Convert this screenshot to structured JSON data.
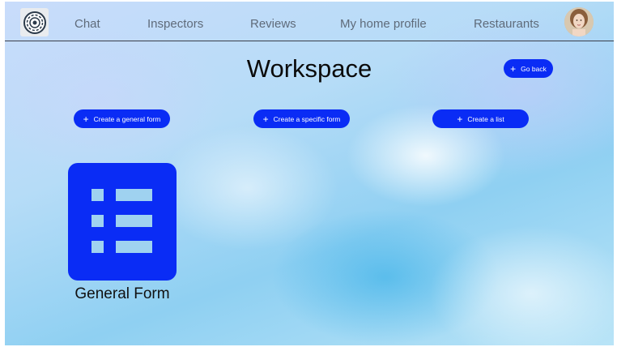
{
  "nav": {
    "items": [
      {
        "label": "Chat"
      },
      {
        "label": "Inspectors"
      },
      {
        "label": "Reviews"
      },
      {
        "label": "My home profile"
      },
      {
        "label": "Restaurants"
      }
    ]
  },
  "main": {
    "title": "Workspace",
    "go_back_label": "Go back",
    "actions": [
      {
        "label": "Create a general form"
      },
      {
        "label": "Create a specific form"
      },
      {
        "label": "Create a list"
      }
    ],
    "forms": [
      {
        "label": "General Form",
        "icon": "list-form-icon"
      }
    ]
  },
  "colors": {
    "accent": "#0a2cf5",
    "nav_text": "#5f6b7a"
  }
}
